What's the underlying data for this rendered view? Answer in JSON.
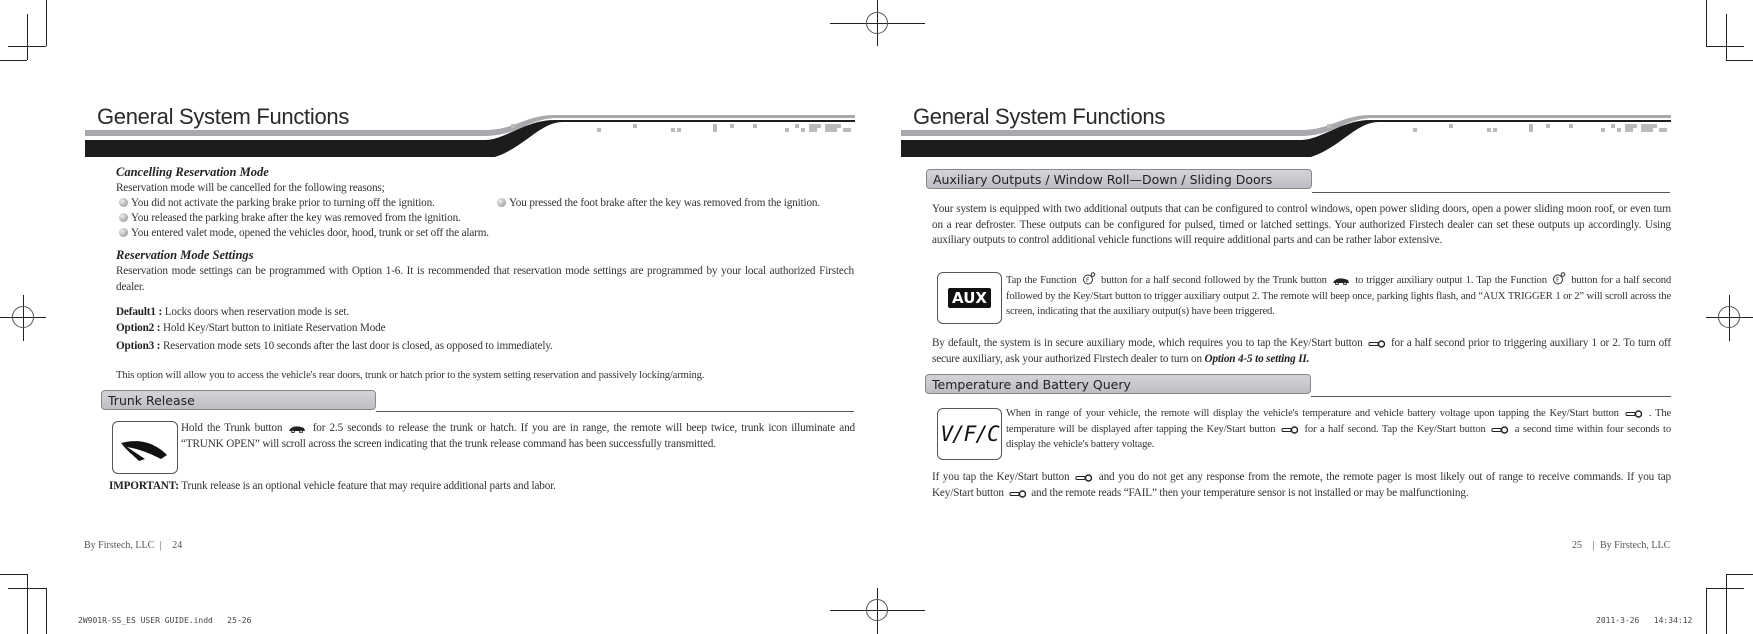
{
  "left_page": {
    "header_title": "General System Functions",
    "cancelling": {
      "heading": "Cancelling Reservation Mode",
      "intro": "Reservation mode will be cancelled for the following reasons;",
      "reasons": [
        "You did not activate the parking brake prior to turning off the ignition.",
        "You pressed the foot brake after the key was removed from the ignition.",
        "You released the parking brake after the key was removed from the ignition.",
        "You entered valet mode, opened the vehicles door, hood, trunk or set off the alarm."
      ]
    },
    "settings": {
      "heading": "Reservation Mode Settings",
      "paragraph": "Reservation mode settings can be programmed with Option 1-6.  It is recommended that reservation mode settings are programmed by your local authorized Firstech dealer.",
      "options": [
        {
          "label": "Default1 :",
          "text": "Locks doors when reservation mode is set."
        },
        {
          "label": "Option2 :",
          "text": "Hold Key/Start button to initiate Reservation Mode"
        },
        {
          "label": "Option3 :",
          "text": "Reservation mode sets 10 seconds after the last door is closed, as opposed to immediately."
        }
      ],
      "note": "This option will allow you to access the vehicle's rear doors, trunk or hatch prior to the system setting reservation and passively locking/arming."
    },
    "trunk": {
      "section_title": "Trunk Release",
      "text_before_icon": "Hold the Trunk button",
      "text_after_icon": "for 2.5 seconds to release the trunk or hatch. If you are in range, the remote will beep twice, trunk icon illuminate and “TRUNK OPEN” will scroll across the screen indicating that the trunk release command has been successfully transmitted.",
      "important_label": "IMPORTANT:",
      "important_text": "Trunk release is an optional vehicle feature that may require additional parts and labor."
    },
    "footer": {
      "company": "By Firstech, LLC",
      "page": "24"
    }
  },
  "right_page": {
    "header_title": "General System Functions",
    "aux": {
      "section_title": "Auxiliary Outputs / Window Roll—Down / Sliding Doors",
      "paragraph": "Your system is equipped with two additional outputs that can be configured to control windows, open power sliding doors, open a power sliding moon roof, or even turn on a rear defroster. These outputs can be configured for pulsed, timed or latched settings. Your authorized Firstech dealer can set these outputs up accordingly. Using auxiliary outputs to control additional vehicle functions will require additional parts and can be rather labor extensive.",
      "icon_label": "AUX",
      "instr_1": "Tap the Function",
      "instr_2": "button for a half second followed by the Trunk button",
      "instr_3": "to trigger auxiliary output 1. Tap the Function",
      "instr_4": "button for a half second followed by the Key/Start button to trigger auxiliary output 2. The remote will beep once, parking lights flash, and “AUX TRIGGER 1 or 2” will scroll across the screen, indicating that the auxiliary output(s) have been triggered.",
      "secure_1": "By default, the system is in secure auxiliary mode, which requires you to tap the Key/Start button",
      "secure_2": "for a half second prior to triggering auxiliary 1 or 2. To turn off secure auxiliary, ask your authorized Firstech dealer to turn on",
      "secure_option": "Option 4-5 to setting II."
    },
    "temp": {
      "section_title": "Temperature and Battery Query",
      "icon_label": "V/F/C",
      "p1_1": "When in range of your vehicle, the remote will display the vehicle's temperature and vehicle battery voltage upon tapping the Key/Start button",
      "p1_2": ". The temperature will be displayed after tapping the Key/Start button",
      "p1_3": "for a half second. Tap the Key/Start button",
      "p1_4": "a second time within four seconds to display the vehicle's battery voltage.",
      "p2_1": "If you tap the Key/Start button",
      "p2_2": "and you do not get any response from the remote, the remote pager is most likely out of range to receive commands. If you tap Key/Start button",
      "p2_3": "and the remote reads “FAIL” then your temperature sensor is not installed or may be malfunctioning."
    },
    "footer": {
      "company": "By Firstech, LLC",
      "page": "25"
    }
  },
  "slug": {
    "file": "2W901R-SS_ES USER GUIDE.indd   25-26",
    "timestamp": "2011-3-26   14:34:12"
  },
  "icons": {
    "bullet": "grey-ball-bullet",
    "trunk": "car-trunk-icon",
    "function": "function-button-icon",
    "key": "key-start-icon"
  }
}
